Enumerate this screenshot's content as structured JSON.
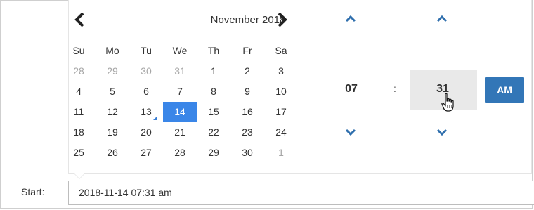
{
  "form": {
    "start_label": "Start:",
    "start_value": "2018-11-14 07:31 am"
  },
  "calendar": {
    "month_title": "November 2018",
    "prev_icon": "chevron-left-icon",
    "next_icon": "chevron-right-icon",
    "weekdays": [
      "Su",
      "Mo",
      "Tu",
      "We",
      "Th",
      "Fr",
      "Sa"
    ],
    "weeks": [
      [
        "28",
        "29",
        "30",
        "31",
        "1",
        "2",
        "3"
      ],
      [
        "4",
        "5",
        "6",
        "7",
        "8",
        "9",
        "10"
      ],
      [
        "11",
        "12",
        "13",
        "14",
        "15",
        "16",
        "17"
      ],
      [
        "18",
        "19",
        "20",
        "21",
        "22",
        "23",
        "24"
      ],
      [
        "25",
        "26",
        "27",
        "28",
        "29",
        "30",
        "1"
      ]
    ],
    "selected_day": "14",
    "today_day": "13"
  },
  "time": {
    "hour": "07",
    "separator": ":",
    "minute": "31",
    "meridiem": "AM",
    "up_icon": "chevron-up-icon",
    "down_icon": "chevron-down-icon"
  },
  "colors": {
    "selected_bg": "#3a86e8",
    "ampm_bg": "#3276b7",
    "arrow_color": "#2f6fad"
  }
}
